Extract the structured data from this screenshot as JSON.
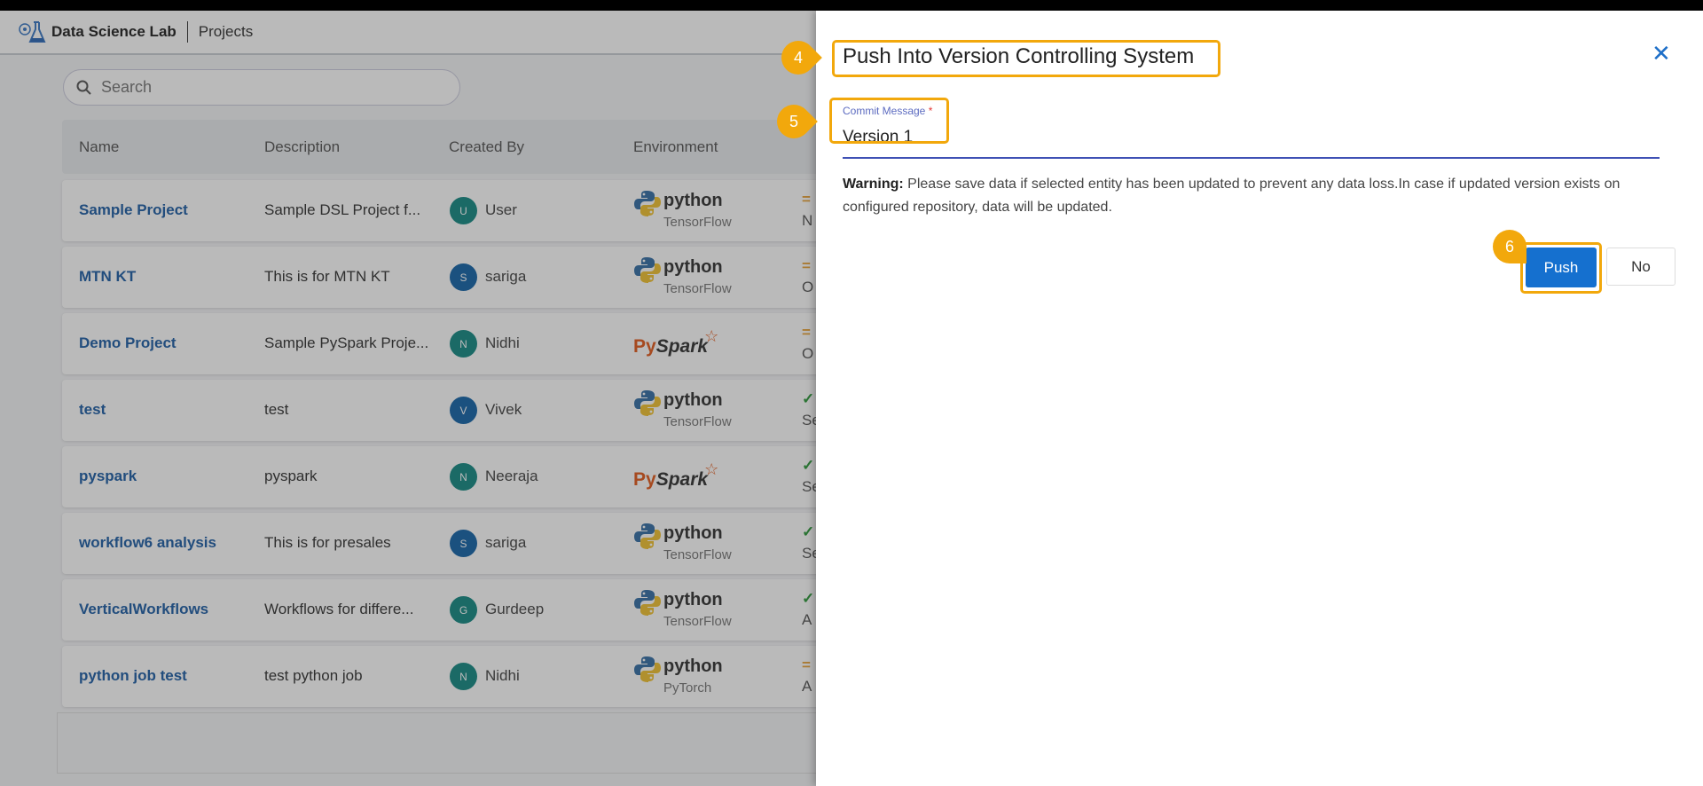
{
  "header": {
    "app_name": "Data Science Lab",
    "breadcrumb": "Projects"
  },
  "search": {
    "placeholder": "Search"
  },
  "table": {
    "columns": [
      "Name",
      "Description",
      "Created By",
      "Environment"
    ],
    "rows": [
      {
        "name": "Sample Project",
        "description": "Sample DSL Project f...",
        "initial": "U",
        "user": "User",
        "avatar_color": "#168a84",
        "env": "python",
        "env_sub": "TensorFlow",
        "status_icon": "=",
        "status_text": "N"
      },
      {
        "name": "MTN KT",
        "description": "This is for MTN KT",
        "initial": "S",
        "user": "sariga",
        "avatar_color": "#1565a8",
        "env": "python",
        "env_sub": "TensorFlow",
        "status_icon": "=",
        "status_text": "O"
      },
      {
        "name": "Demo Project",
        "description": "Sample PySpark Proje...",
        "initial": "N",
        "user": "Nidhi",
        "avatar_color": "#168a84",
        "env": "pyspark",
        "env_sub": "",
        "status_icon": "=",
        "status_text": "O"
      },
      {
        "name": "test",
        "description": "test",
        "initial": "V",
        "user": "Vivek",
        "avatar_color": "#1565a8",
        "env": "python",
        "env_sub": "TensorFlow",
        "status_icon": "✓",
        "status_text": "Se"
      },
      {
        "name": "pyspark",
        "description": "pyspark",
        "initial": "N",
        "user": "Neeraja",
        "avatar_color": "#168a84",
        "env": "pyspark",
        "env_sub": "",
        "status_icon": "✓",
        "status_text": "Se"
      },
      {
        "name": "workflow6 analysis",
        "description": "This is for presales",
        "initial": "S",
        "user": "sariga",
        "avatar_color": "#1565a8",
        "env": "python",
        "env_sub": "TensorFlow",
        "status_icon": "✓",
        "status_text": "Se"
      },
      {
        "name": "VerticalWorkflows",
        "description": "Workflows for differe...",
        "initial": "G",
        "user": "Gurdeep",
        "avatar_color": "#168a84",
        "env": "python",
        "env_sub": "TensorFlow",
        "status_icon": "✓",
        "status_text": "A"
      },
      {
        "name": "python job test",
        "description": "test python job",
        "initial": "N",
        "user": "Nidhi",
        "avatar_color": "#168a84",
        "env": "python",
        "env_sub": "PyTorch",
        "status_icon": "=",
        "status_text": "A"
      }
    ]
  },
  "env_labels": {
    "python": "python",
    "pyspark_py": "Py",
    "pyspark_spark": "Spark"
  },
  "dialog": {
    "title": "Push Into Version Controlling System",
    "close_icon": "close-icon",
    "commit_label": "Commit Message",
    "required_mark": "*",
    "commit_value": "Version 1",
    "warning_label": "Warning:",
    "warning_text": " Please save data if selected entity has been updated to prevent any data loss.In case if updated version exists on configured repository, data will be updated.",
    "push_label": "Push",
    "no_label": "No"
  },
  "annotations": {
    "title_step": "4",
    "input_step": "5",
    "push_step": "6",
    "color": "#f2a80c"
  }
}
